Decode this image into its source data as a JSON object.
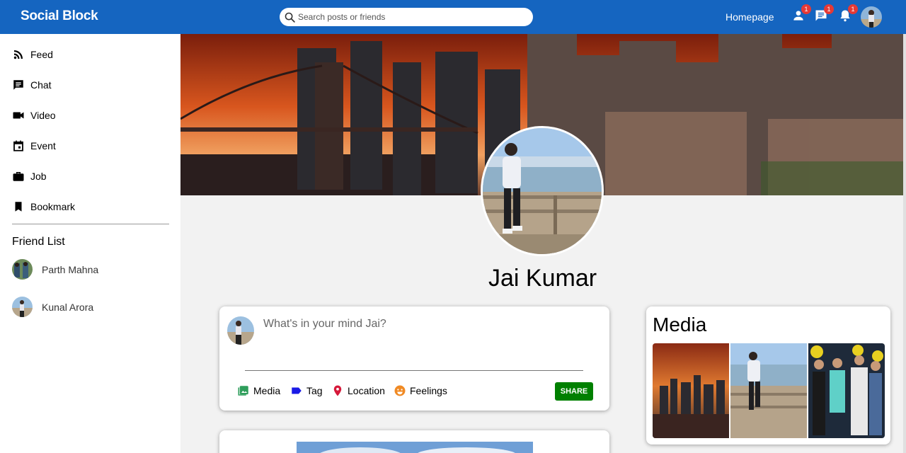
{
  "header": {
    "brand": "Social Block",
    "search_placeholder": "Search posts or friends",
    "home_link": "Homepage",
    "friend_requests_badge": "1",
    "messages_badge": "1",
    "notifications_badge": "1"
  },
  "sidebar": {
    "items": [
      {
        "label": "Feed",
        "icon": "rss-feed-icon"
      },
      {
        "label": "Chat",
        "icon": "chat-icon"
      },
      {
        "label": "Video",
        "icon": "video-camera-icon"
      },
      {
        "label": "Event",
        "icon": "calendar-icon"
      },
      {
        "label": "Job",
        "icon": "briefcase-icon"
      },
      {
        "label": "Bookmark",
        "icon": "bookmark-icon"
      }
    ],
    "friend_list_title": "Friend List",
    "friends": [
      {
        "name": "Parth Mahna"
      },
      {
        "name": "Kunal Arora"
      }
    ]
  },
  "profile": {
    "name": "Jai Kumar"
  },
  "composer": {
    "placeholder": "What's in your mind Jai?",
    "options": [
      {
        "label": "Media",
        "icon": "image-icon",
        "color": "#2e9e5b"
      },
      {
        "label": "Tag",
        "icon": "label-icon",
        "color": "#1a1ae6"
      },
      {
        "label": "Location",
        "icon": "location-pin-icon",
        "color": "#d6193a"
      },
      {
        "label": "Feelings",
        "icon": "smiley-icon",
        "color": "#f08a24"
      }
    ],
    "share_label": "SHARE"
  },
  "media_panel": {
    "title": "Media"
  },
  "colors": {
    "topbar": "#1565c0",
    "share_button": "#008000",
    "badge": "#e53935"
  }
}
